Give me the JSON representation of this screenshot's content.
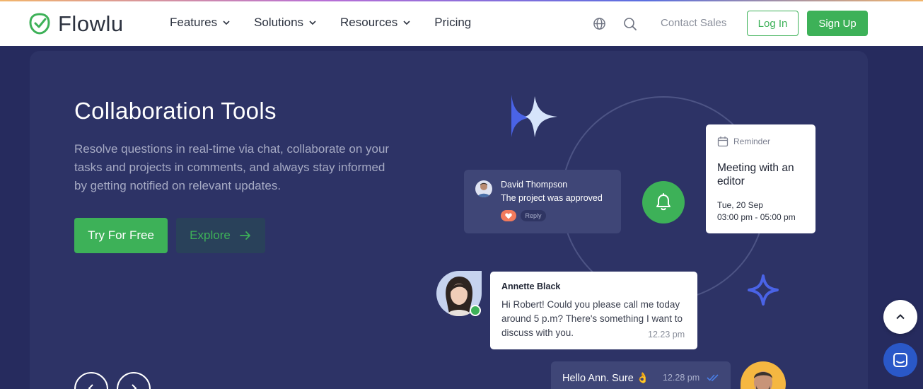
{
  "brand": {
    "name": "Flowlu",
    "color": "#3db158"
  },
  "nav": {
    "items": [
      {
        "label": "Features",
        "has_dropdown": true
      },
      {
        "label": "Solutions",
        "has_dropdown": true
      },
      {
        "label": "Resources",
        "has_dropdown": true
      },
      {
        "label": "Pricing",
        "has_dropdown": false
      }
    ],
    "contact_sales": "Contact Sales",
    "login": "Log In",
    "signup": "Sign Up"
  },
  "hero": {
    "title": "Collaboration Tools",
    "description": "Resolve questions in real-time via chat, collaborate on your tasks and projects in comments, and always stay informed by getting notified on relevant updates.",
    "try_button": "Try For Free",
    "explore_button": "Explore"
  },
  "illustration": {
    "david": {
      "name": "David Thompson",
      "message": "The project was approved",
      "reply": "Reply"
    },
    "reminder": {
      "label": "Reminder",
      "title": "Meeting with an editor",
      "date": "Tue, 20 Sep",
      "time": "03:00 pm - 05:00 pm"
    },
    "annette": {
      "name": "Annette Black",
      "message": "Hi Robert! Could you please call me today around 5 p.m? There's something I want to discuss with you.",
      "time": "12.23 pm"
    },
    "hello": {
      "message": "Hello Ann. Sure 👌",
      "time": "12.28 pm"
    }
  },
  "colors": {
    "hero_bg": "#2d3366",
    "page_bg": "#262b5e",
    "accent": "#3db158",
    "chat_blue": "#2a58c8"
  }
}
